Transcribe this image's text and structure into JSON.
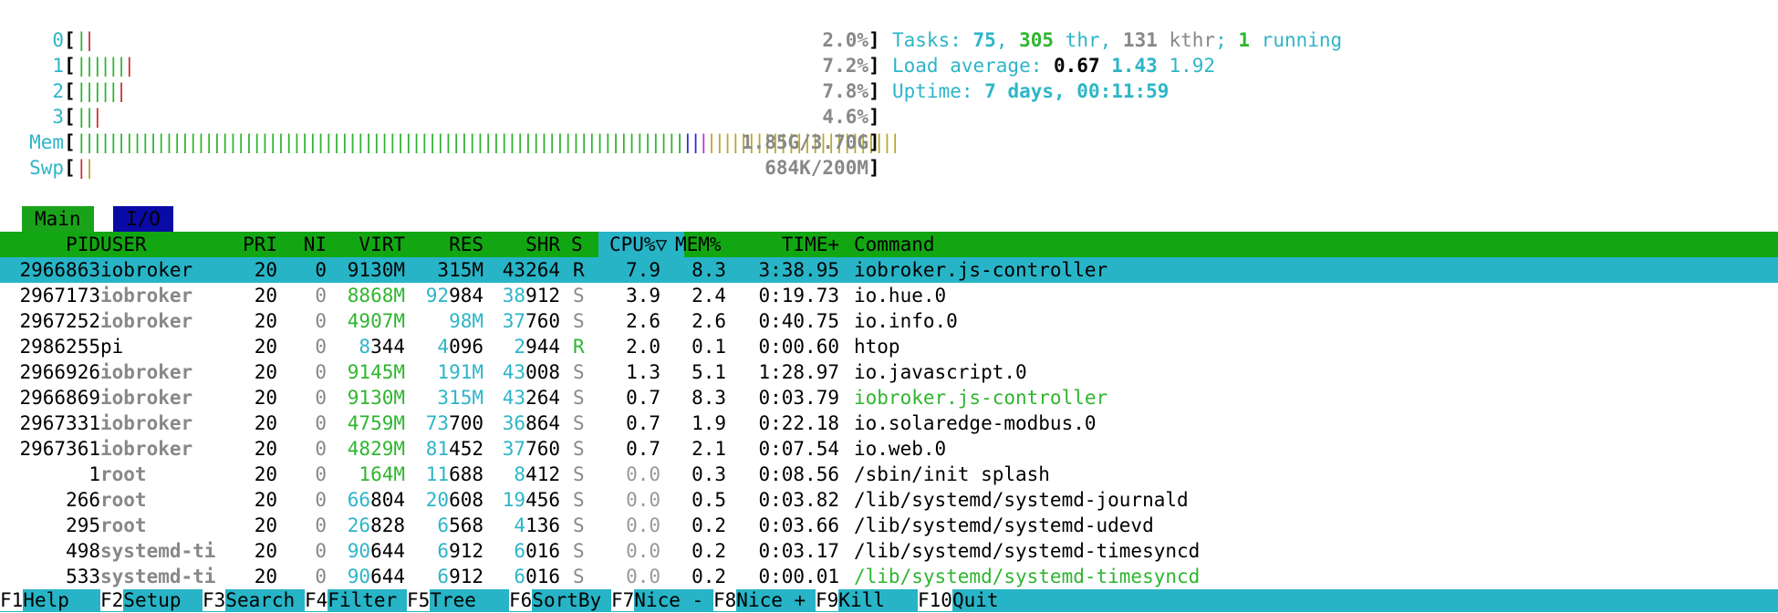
{
  "cpus": [
    {
      "label": "0",
      "bars": [
        {
          "t": "|",
          "c": "green"
        },
        {
          "t": "|",
          "c": "red"
        }
      ],
      "value": "2.0%"
    },
    {
      "label": "1",
      "bars": [
        {
          "t": "||||||",
          "c": "green"
        },
        {
          "t": "|",
          "c": "red"
        }
      ],
      "value": "7.2%"
    },
    {
      "label": "2",
      "bars": [
        {
          "t": "|||||",
          "c": "green"
        },
        {
          "t": "|",
          "c": "red"
        }
      ],
      "value": "7.8%"
    },
    {
      "label": "3",
      "bars": [
        {
          "t": "||",
          "c": "green"
        },
        {
          "t": "|",
          "c": "red"
        }
      ],
      "value": "4.6%"
    }
  ],
  "mem": {
    "label": "Mem",
    "bars": [
      {
        "t": "||||||||||||||||||||||||||||||||||||||||||||||||||||||||||||||||||||||||||||",
        "c": "green"
      },
      {
        "t": "||",
        "c": "blue"
      },
      {
        "t": "|",
        "c": "magenta"
      },
      {
        "t": "||||||||||||||||||||||||",
        "c": "yellow"
      }
    ],
    "value": "1.85G/3.70G"
  },
  "swap": {
    "label": "Swp",
    "bars": [
      {
        "t": "|",
        "c": "red"
      },
      {
        "t": "|",
        "c": "yellow"
      }
    ],
    "value": "684K/200M"
  },
  "summary": {
    "tasks_label": "Tasks: ",
    "tasks": "75",
    "threads": "305",
    "threads_label": " thr",
    "kthreads": "131",
    "kthreads_label": " kthr",
    "running": "1",
    "running_label": " running",
    "load_label": "Load average: ",
    "load1": "0.67",
    "load5": "1.43",
    "load15": "1.92",
    "uptime_label": "Uptime: ",
    "uptime": "7 days, 00:11:59"
  },
  "tabs": {
    "main": "Main",
    "io": "I/O"
  },
  "columns": {
    "pid": "PID",
    "user": "USER",
    "pri": "PRI",
    "ni": "NI",
    "virt": "VIRT",
    "res": "RES",
    "shr": "SHR",
    "s": "S",
    "cpu": "CPU%▽",
    "mem": "MEM%",
    "time": "TIME+",
    "command": "Command"
  },
  "processes": [
    {
      "pid": "2966863",
      "user": "iobroker",
      "pri": "20",
      "ni": "0",
      "virt": "9130M",
      "res": "315M",
      "shr": "43264",
      "s": "R",
      "cpu": "7.9",
      "mem": "8.3",
      "time": "3:38.95",
      "command": "iobroker.js-controller",
      "selected": true
    },
    {
      "pid": "2967173",
      "user": "iobroker",
      "pri": "20",
      "ni": "0",
      "virt": "8868M",
      "res": "92984",
      "shr": "38912",
      "s": "S",
      "cpu": "3.9",
      "mem": "2.4",
      "time": "0:19.73",
      "command": "io.hue.0"
    },
    {
      "pid": "2967252",
      "user": "iobroker",
      "pri": "20",
      "ni": "0",
      "virt": "4907M",
      "res": "98M",
      "shr": "37760",
      "s": "S",
      "cpu": "2.6",
      "mem": "2.6",
      "time": "0:40.75",
      "command": "io.info.0"
    },
    {
      "pid": "2986255",
      "user": "pi",
      "pri": "20",
      "ni": "0",
      "virt": "8344",
      "res": "4096",
      "shr": "2944",
      "s": "R",
      "cpu": "2.0",
      "mem": "0.1",
      "time": "0:00.60",
      "command": "htop"
    },
    {
      "pid": "2966926",
      "user": "iobroker",
      "pri": "20",
      "ni": "0",
      "virt": "9145M",
      "res": "191M",
      "shr": "43008",
      "s": "S",
      "cpu": "1.3",
      "mem": "5.1",
      "time": "1:28.97",
      "command": "io.javascript.0"
    },
    {
      "pid": "2966869",
      "user": "iobroker",
      "pri": "20",
      "ni": "0",
      "virt": "9130M",
      "res": "315M",
      "shr": "43264",
      "s": "S",
      "cpu": "0.7",
      "mem": "8.3",
      "time": "0:03.79",
      "command": "iobroker.js-controller",
      "thread": true
    },
    {
      "pid": "2967331",
      "user": "iobroker",
      "pri": "20",
      "ni": "0",
      "virt": "4759M",
      "res": "73700",
      "shr": "36864",
      "s": "S",
      "cpu": "0.7",
      "mem": "1.9",
      "time": "0:22.18",
      "command": "io.solaredge-modbus.0"
    },
    {
      "pid": "2967361",
      "user": "iobroker",
      "pri": "20",
      "ni": "0",
      "virt": "4829M",
      "res": "81452",
      "shr": "37760",
      "s": "S",
      "cpu": "0.7",
      "mem": "2.1",
      "time": "0:07.54",
      "command": "io.web.0"
    },
    {
      "pid": "1",
      "user": "root",
      "pri": "20",
      "ni": "0",
      "virt": "164M",
      "res": "11688",
      "shr": "8412",
      "s": "S",
      "cpu": "0.0",
      "mem": "0.3",
      "time": "0:08.56",
      "command": "/sbin/init splash"
    },
    {
      "pid": "266",
      "user": "root",
      "pri": "20",
      "ni": "0",
      "virt": "66804",
      "res": "20608",
      "shr": "19456",
      "s": "S",
      "cpu": "0.0",
      "mem": "0.5",
      "time": "0:03.82",
      "command": "/lib/systemd/systemd-journald"
    },
    {
      "pid": "295",
      "user": "root",
      "pri": "20",
      "ni": "0",
      "virt": "26828",
      "res": "6568",
      "shr": "4136",
      "s": "S",
      "cpu": "0.0",
      "mem": "0.2",
      "time": "0:03.66",
      "command": "/lib/systemd/systemd-udevd"
    },
    {
      "pid": "498",
      "user": "systemd-ti",
      "pri": "20",
      "ni": "0",
      "virt": "90644",
      "res": "6912",
      "shr": "6016",
      "s": "S",
      "cpu": "0.0",
      "mem": "0.2",
      "time": "0:03.17",
      "command": "/lib/systemd/systemd-timesyncd"
    },
    {
      "pid": "533",
      "user": "systemd-ti",
      "pri": "20",
      "ni": "0",
      "virt": "90644",
      "res": "6912",
      "shr": "6016",
      "s": "S",
      "cpu": "0.0",
      "mem": "0.2",
      "time": "0:00.01",
      "command": "/lib/systemd/systemd-timesyncd",
      "thread": true
    }
  ],
  "footer": [
    {
      "key": "F1",
      "label": "Help"
    },
    {
      "key": "F2",
      "label": "Setup"
    },
    {
      "key": "F3",
      "label": "Search"
    },
    {
      "key": "F4",
      "label": "Filter"
    },
    {
      "key": "F5",
      "label": "Tree"
    },
    {
      "key": "F6",
      "label": "SortBy"
    },
    {
      "key": "F7",
      "label": "Nice -"
    },
    {
      "key": "F8",
      "label": "Nice +"
    },
    {
      "key": "F9",
      "label": "Kill"
    },
    {
      "key": "F10",
      "label": "Quit"
    }
  ],
  "colors": {
    "cyan": "#2eb5c8",
    "green": "#2fb52f",
    "red": "#c93030",
    "header_bg": "#12a712",
    "selected_bg": "#27b4c6"
  }
}
